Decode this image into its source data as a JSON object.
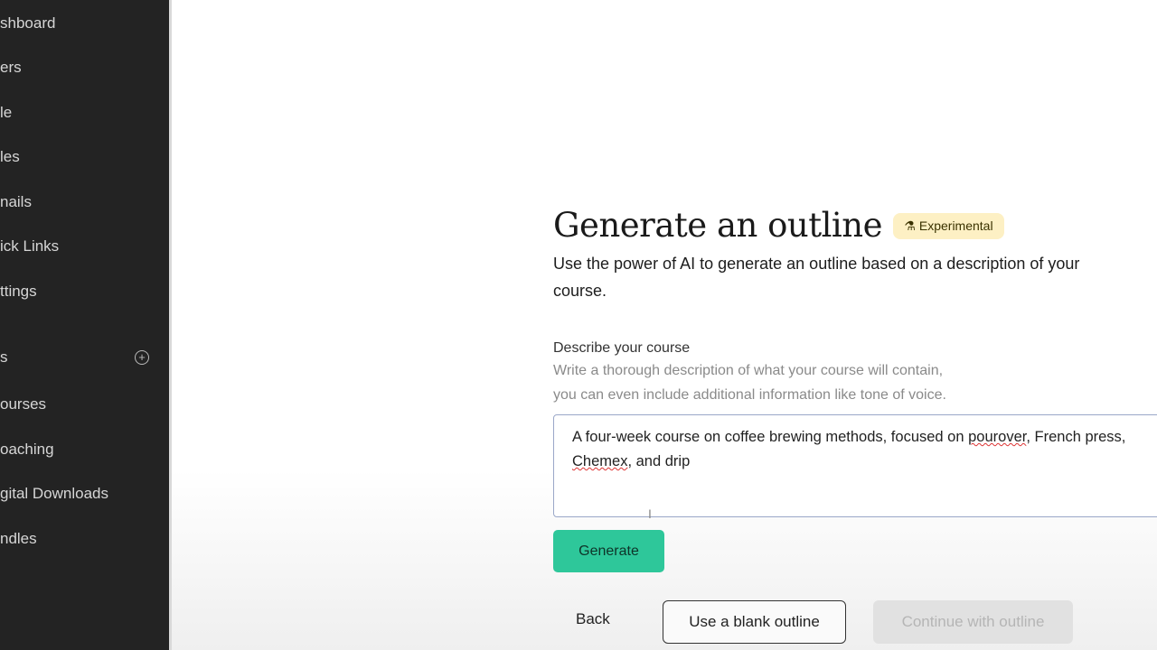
{
  "sidebar": {
    "items": [
      {
        "label": "shboard"
      },
      {
        "label": "ers"
      },
      {
        "label": "le"
      },
      {
        "label": "les"
      },
      {
        "label": "nails"
      },
      {
        "label": "ick Links"
      },
      {
        "label": "ttings"
      }
    ],
    "section": {
      "label": "s",
      "add_icon": "plus-circle-icon"
    },
    "products": [
      {
        "label": "ourses"
      },
      {
        "label": "oaching"
      },
      {
        "label": "gital Downloads"
      },
      {
        "label": "ndles"
      }
    ]
  },
  "main": {
    "title": "Generate an outline",
    "badge": {
      "label": "Experimental",
      "icon": "flask-icon",
      "color": "#fdf0c4"
    },
    "subtitle": "Use the power of AI to generate an outline based on a description of your course.",
    "field": {
      "label": "Describe your course",
      "hint_line1": "Write a thorough description of what your course will contain,",
      "hint_line2": "you can even include additional information like tone of voice.",
      "value_part1": "A four-week course on coffee brewing methods, focused on ",
      "value_misspelled1": "pourover",
      "value_part2": ", French press, ",
      "value_misspelled2": "Chemex",
      "value_part3": ", and drip"
    },
    "generate_label": "Generate",
    "back_label": "Back",
    "blank_label": "Use a blank outline",
    "continue_label": "Continue with outline",
    "accent_color": "#2ec79a"
  }
}
